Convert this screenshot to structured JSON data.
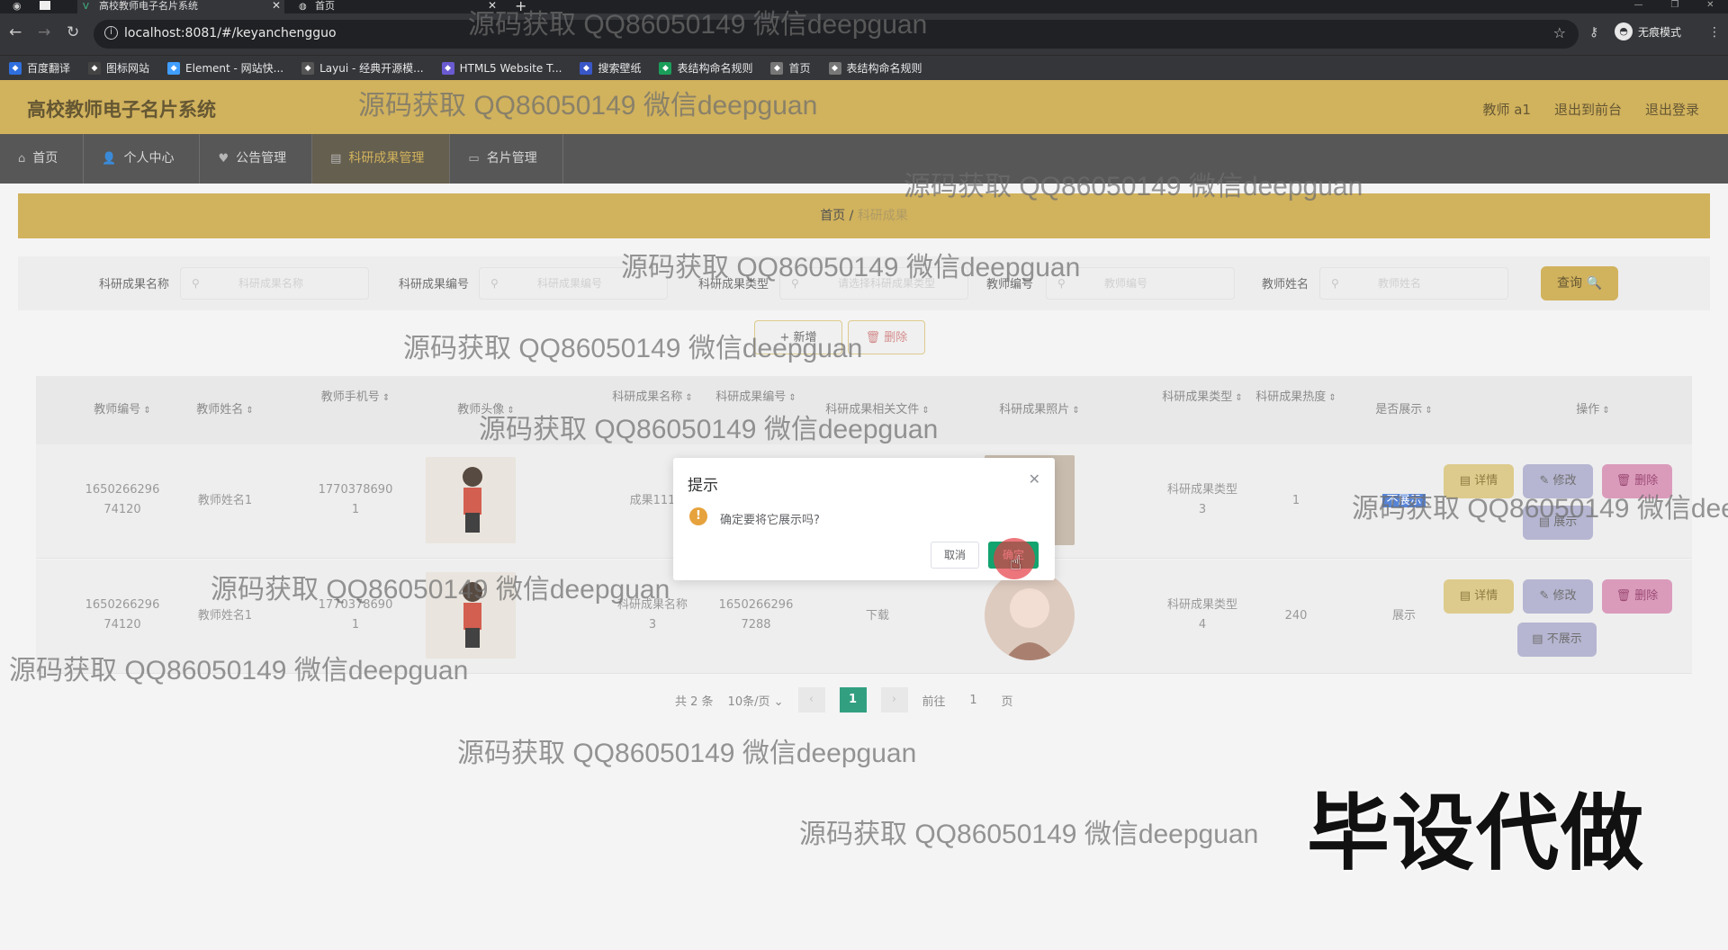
{
  "browser": {
    "tabs": [
      {
        "title": "高校教师电子名片系统"
      },
      {
        "title": "首页"
      }
    ],
    "url": "localhost:8081/#/keyanchengguo",
    "incognito_label": "无痕模式",
    "bookmarks": [
      {
        "label": "百度翻译",
        "color": "#2f6fde"
      },
      {
        "label": "图标网站",
        "color": "#444"
      },
      {
        "label": "Element - 网站快...",
        "color": "#409eff"
      },
      {
        "label": "Layui - 经典开源模...",
        "color": "#555"
      },
      {
        "label": "HTML5 Website T...",
        "color": "#6b5bd2"
      },
      {
        "label": "搜索壁纸",
        "color": "#3a57c8"
      },
      {
        "label": "表结构命名规则",
        "color": "#1b9e5a"
      },
      {
        "label": "首页",
        "color": "#777"
      },
      {
        "label": "表结构命名规则",
        "color": "#777"
      }
    ]
  },
  "app": {
    "title": "高校教师电子名片系统",
    "user_links": [
      "教师 a1",
      "退出到前台",
      "退出登录"
    ],
    "nav": [
      {
        "label": "首页",
        "icon": "home-icon",
        "glyph": "⌂"
      },
      {
        "label": "个人中心",
        "icon": "user-icon",
        "glyph": "👤"
      },
      {
        "label": "公告管理",
        "icon": "bell-icon",
        "glyph": "♥"
      },
      {
        "label": "科研成果管理",
        "icon": "doc-icon",
        "glyph": "▤"
      },
      {
        "label": "名片管理",
        "icon": "card-icon",
        "glyph": "▭"
      }
    ],
    "active_nav": 3,
    "breadcrumb": {
      "home": "首页",
      "sep": "/",
      "current": "科研成果"
    }
  },
  "search": {
    "fields": [
      {
        "label": "科研成果名称",
        "placeholder": "科研成果名称"
      },
      {
        "label": "科研成果编号",
        "placeholder": "科研成果编号"
      },
      {
        "label": "科研成果类型",
        "placeholder": "请选择科研成果类型"
      },
      {
        "label": "教师编号",
        "placeholder": "教师编号"
      },
      {
        "label": "教师姓名",
        "placeholder": "教师姓名"
      }
    ],
    "query_label": "查询 🔍"
  },
  "actions": {
    "add": "+ 新增",
    "delete": "🗑 删除"
  },
  "table": {
    "headers": [
      "教师编号",
      "教师姓名",
      "教师手机号",
      "教师头像",
      "科研成果名称",
      "科研成果编号",
      "科研成果相关文件",
      "科研成果照片",
      "科研成果类型",
      "科研成果热度",
      "是否展示",
      "操作"
    ],
    "rows": [
      {
        "teacher_no": [
          "1650266296",
          "74120"
        ],
        "teacher_name": "教师姓名1",
        "phone": [
          "1770378690",
          "1"
        ],
        "name": [
          "成果111"
        ],
        "code": [],
        "file": "",
        "type": [
          "科研成果类型",
          "3"
        ],
        "heat": "1",
        "show": "不展示",
        "toggle": "▤ 展示"
      },
      {
        "teacher_no": [
          "1650266296",
          "74120"
        ],
        "teacher_name": "教师姓名1",
        "phone": [
          "1770378690",
          "1"
        ],
        "name": [
          "科研成果名称",
          "3"
        ],
        "code": [
          "1650266296",
          "7288"
        ],
        "file": "下载",
        "type": [
          "科研成果类型",
          "4"
        ],
        "heat": "240",
        "show": "展示",
        "toggle": "▤ 不展示"
      }
    ],
    "row_actions": {
      "detail": "▤ 详情",
      "edit": "✎ 修改",
      "delete": "🗑 删除"
    }
  },
  "pager": {
    "total": "共 2 条",
    "size": "10条/页",
    "page": "1",
    "goto": "前往",
    "goto_value": "1",
    "unit": "页"
  },
  "dialog": {
    "title": "提示",
    "message": "确定要将它展示吗?",
    "cancel": "取消",
    "confirm": "确定"
  },
  "watermarks": {
    "text": "源码获取 QQ86050149 微信deepguan",
    "big": "毕设代做"
  }
}
